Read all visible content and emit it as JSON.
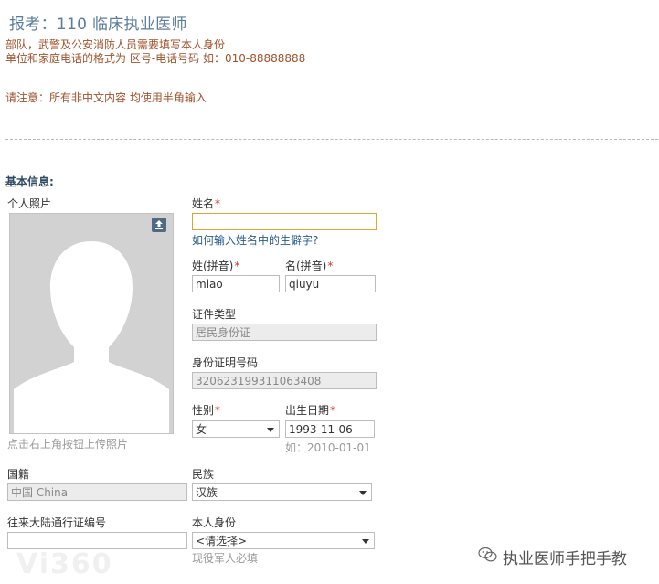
{
  "header": {
    "title": "报考：110 临床执业医师",
    "notes": [
      "部队，武警及公安消防人员需要填写本人身份",
      "单位和家庭电话的格式为 区号-电话号码 如：010-88888888",
      "请注意：所有非中文内容 均使用半角输入"
    ]
  },
  "section": {
    "title": "基本信息:"
  },
  "photo": {
    "label": "个人照片",
    "hint": "点击右上角按钮上传照片",
    "upload_icon": "upload-icon"
  },
  "fields": {
    "name": {
      "label": "姓名",
      "required": "*",
      "value": "",
      "help_link": "如何输入姓名中的生僻字?"
    },
    "surname_pinyin": {
      "label": "姓(拼音)",
      "required": "*",
      "value": "miao"
    },
    "given_pinyin": {
      "label": "名(拼音)",
      "required": "*",
      "value": "qiuyu"
    },
    "id_type": {
      "label": "证件类型",
      "value": "居民身份证"
    },
    "id_number": {
      "label": "身份证明号码",
      "value": "320623199311063408"
    },
    "gender": {
      "label": "性别",
      "required": "*",
      "value": "女"
    },
    "birth_date": {
      "label": "出生日期",
      "required": "*",
      "value": "1993-11-06",
      "hint": "如：2010-01-01"
    },
    "nationality": {
      "label": "国籍",
      "value": "中国 China"
    },
    "ethnicity": {
      "label": "民族",
      "value": "汉族"
    },
    "permit_number": {
      "label": "往来大陆通行证编号",
      "value": ""
    },
    "identity": {
      "label": "本人身份",
      "value": "<请选择>",
      "hint": "现役军人必填"
    }
  },
  "watermark": {
    "text": "执业医师手把手教",
    "faint": "Vi360"
  },
  "colors": {
    "accent_title": "#5b7d9b",
    "note": "#a0522d",
    "required": "#d9342b",
    "link": "#2a5d8a"
  }
}
